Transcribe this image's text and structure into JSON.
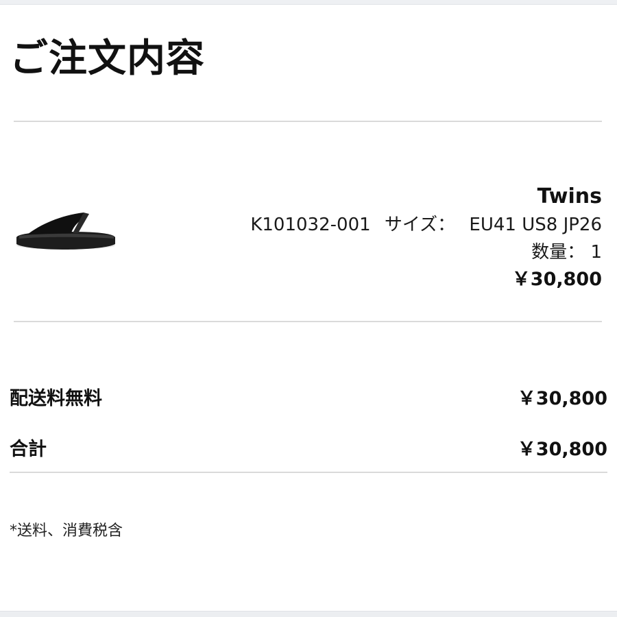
{
  "order": {
    "title": "ご注文内容"
  },
  "item": {
    "image_icon": "black-flip-flop-sandal",
    "name": "Twins",
    "sku": "K101032-001",
    "size_label": "サイズ：",
    "size_value": "EU41 US8 JP26",
    "quantity_label": "数量：",
    "quantity_value": "1",
    "price": "￥30,800"
  },
  "summary": {
    "shipping_label": "配送料無料",
    "shipping_value": "￥30,800",
    "total_label": "合計",
    "total_value": "￥30,800"
  },
  "footnote": "*送料、消費税含"
}
